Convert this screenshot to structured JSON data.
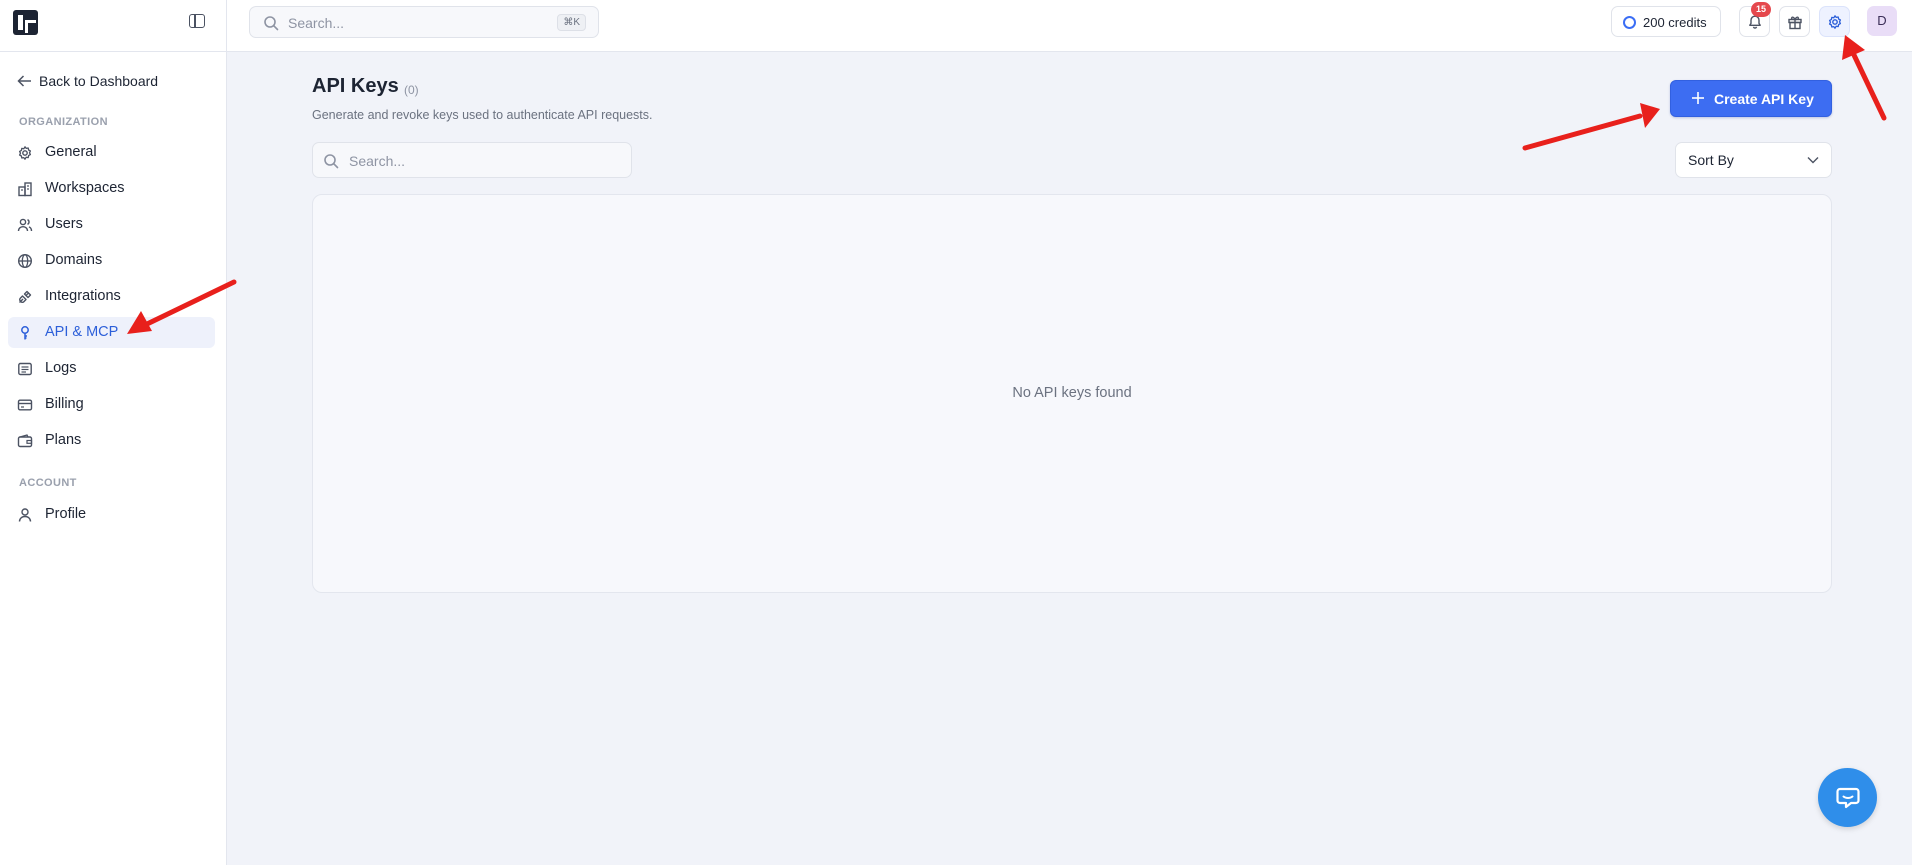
{
  "topbar": {
    "search": {
      "placeholder": "Search...",
      "shortcut": "⌘K"
    },
    "credits": "200 credits",
    "notifications_count": "15",
    "avatar_initial": "D",
    "icons": [
      "sidebar-toggle-icon",
      "search-icon",
      "bell-icon",
      "gift-icon",
      "gear-icon"
    ]
  },
  "sidebar": {
    "back_label": "Back to Dashboard",
    "organization_label": "ORGANIZATION",
    "organization_items": [
      {
        "label": "General",
        "icon": "gear-icon"
      },
      {
        "label": "Workspaces",
        "icon": "building-icon"
      },
      {
        "label": "Users",
        "icon": "users-icon"
      },
      {
        "label": "Domains",
        "icon": "globe-icon"
      },
      {
        "label": "Integrations",
        "icon": "plug-icon"
      },
      {
        "label": "API & MCP",
        "icon": "key-icon",
        "active": true
      },
      {
        "label": "Logs",
        "icon": "logs-icon"
      },
      {
        "label": "Billing",
        "icon": "credit-card-icon"
      },
      {
        "label": "Plans",
        "icon": "wallet-icon"
      }
    ],
    "account_label": "ACCOUNT",
    "account_items": [
      {
        "label": "Profile",
        "icon": "user-icon"
      }
    ]
  },
  "main": {
    "title": "API Keys",
    "count": "(0)",
    "subtitle": "Generate and revoke keys used to authenticate API requests.",
    "create_button": "Create API Key",
    "search_placeholder": "Search...",
    "sort_label": "Sort By",
    "empty_message": "No API keys found"
  },
  "colors": {
    "accent": "#3d6df2",
    "active_nav_text": "#2c5fd9",
    "annotation_arrow": "#e8201c",
    "chat_button": "#2f8eea",
    "badge": "#e5484d"
  }
}
